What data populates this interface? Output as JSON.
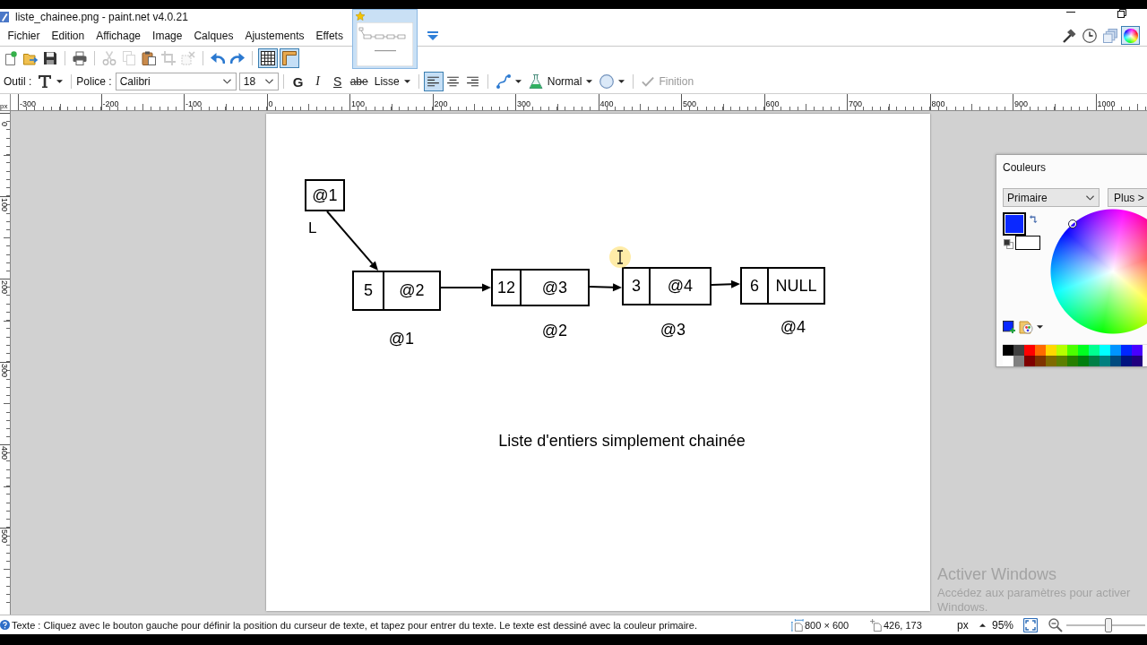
{
  "window": {
    "title": "liste_chainee.png - paint.net v4.0.21"
  },
  "menu": [
    "Fichier",
    "Edition",
    "Affichage",
    "Image",
    "Calques",
    "Ajustements",
    "Effets"
  ],
  "images": [
    {
      "selected": true,
      "unsaved": true
    }
  ],
  "panel_toggles": [
    {
      "kind": "tools",
      "selected": false
    },
    {
      "kind": "history",
      "selected": false
    },
    {
      "kind": "layers",
      "selected": false
    },
    {
      "kind": "colors",
      "selected": true
    }
  ],
  "toolbar": {
    "selection_actions_disabled": true,
    "pixel_grid_on": true,
    "rulers_on": true
  },
  "tool_options": {
    "tool_label": "Outil :",
    "font_label": "Police :",
    "font": "Calibri",
    "size": "18",
    "styles": [
      {
        "kind": "bold",
        "label": "G",
        "selected": false
      },
      {
        "kind": "italic",
        "label": "I",
        "selected": false
      },
      {
        "kind": "underline",
        "label": "S",
        "selected": false
      },
      {
        "kind": "strike",
        "label": "abe",
        "selected": false
      }
    ],
    "rendering": "Lisse",
    "alignment": [
      {
        "kind": "left",
        "selected": true
      },
      {
        "kind": "center",
        "selected": false
      },
      {
        "kind": "right",
        "selected": false
      }
    ],
    "blend_mode": "Normal",
    "finish": "Finition",
    "finish_disabled": true
  },
  "rulers": {
    "unit": "px",
    "horizontal": [
      "-300",
      "-200",
      "-100",
      "0",
      "100",
      "200",
      "300",
      "400",
      "500",
      "600",
      "700",
      "800",
      "900",
      "1000"
    ],
    "vertical": [
      "0",
      "100",
      "200",
      "300",
      "400",
      "500"
    ]
  },
  "drawing": {
    "head": {
      "value": "@1",
      "label": "L"
    },
    "nodes": [
      {
        "value": "5",
        "next": "@2",
        "address": "@1"
      },
      {
        "value": "12",
        "next": "@3",
        "address": "@2"
      },
      {
        "value": "3",
        "next": "@4",
        "address": "@3"
      },
      {
        "value": "6",
        "next": "NULL",
        "address": "@4"
      }
    ],
    "caption": "Liste d'entiers simplement chainée"
  },
  "colors_panel": {
    "title": "Couleurs",
    "target": "Primaire",
    "more": "Plus >",
    "swatches": [
      {
        "kind": "primary",
        "color": "#0a28ff"
      },
      {
        "kind": "secondary",
        "color": "#ffffff"
      }
    ],
    "palette": [
      [
        {
          "color": "#000000"
        },
        {
          "color": "#404040"
        },
        {
          "color": "#ff0000"
        },
        {
          "color": "#ff6a00"
        },
        {
          "color": "#ffd800"
        },
        {
          "color": "#b6ff00"
        },
        {
          "color": "#4cff00"
        },
        {
          "color": "#00ff21"
        },
        {
          "color": "#00ff90"
        },
        {
          "color": "#00ffff"
        },
        {
          "color": "#0094ff"
        },
        {
          "color": "#0026ff"
        },
        {
          "color": "#4800ff"
        }
      ],
      [
        {
          "color": "#ffffff"
        },
        {
          "color": "#808080"
        },
        {
          "color": "#7f0000"
        },
        {
          "color": "#7f3300"
        },
        {
          "color": "#7f6a00"
        },
        {
          "color": "#5b7f00"
        },
        {
          "color": "#267f00"
        },
        {
          "color": "#007f0e"
        },
        {
          "color": "#007f46"
        },
        {
          "color": "#007f7f"
        },
        {
          "color": "#004a7f"
        },
        {
          "color": "#00137f"
        },
        {
          "color": "#21007f"
        }
      ]
    ]
  },
  "watermark": {
    "title": "Activer Windows",
    "text": "Accédez aux paramètres pour activer Windows."
  },
  "status_bar": {
    "hint": "Texte : Cliquez avec le bouton gauche pour définir la position du curseur de texte, et tapez pour entrer du texte. Le texte est dessiné avec la couleur primaire.",
    "image_size": "800 × 600",
    "cursor_position": "426, 173",
    "unit": "px",
    "zoom": "95%",
    "zoom_slider": {
      "level": 0.53
    }
  }
}
